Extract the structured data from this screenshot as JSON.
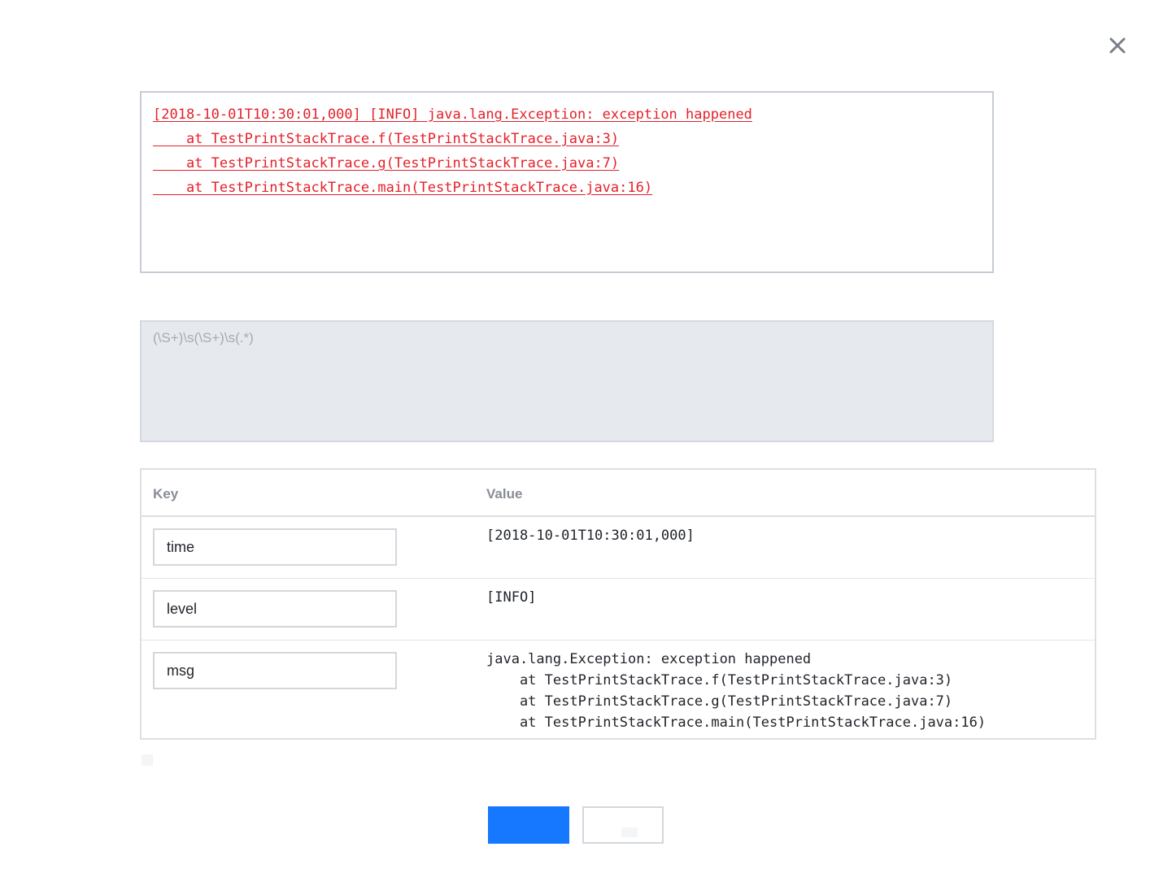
{
  "dialog": {
    "close_icon": "close-icon"
  },
  "log_sample": {
    "lines": [
      "[2018-10-01T10:30:01,000] [INFO] java.lang.Exception: exception happened",
      "    at TestPrintStackTrace.f(TestPrintStackTrace.java:3)",
      "    at TestPrintStackTrace.g(TestPrintStackTrace.java:7)",
      "    at TestPrintStackTrace.main(TestPrintStackTrace.java:16)"
    ],
    "text_color": "#e5202a"
  },
  "regex": {
    "value": "(\\S+)\\s(\\S+)\\s(.*)"
  },
  "kv_table": {
    "headers": {
      "key": "Key",
      "value": "Value"
    },
    "rows": [
      {
        "key": "time",
        "value": "[2018-10-01T10:30:01,000]"
      },
      {
        "key": "level",
        "value": "[INFO]"
      },
      {
        "key": "msg",
        "value": "java.lang.Exception: exception happened\n    at TestPrintStackTrace.f(TestPrintStackTrace.java:3)\n    at TestPrintStackTrace.g(TestPrintStackTrace.java:7)\n    at TestPrintStackTrace.main(TestPrintStackTrace.java:16)"
      }
    ]
  },
  "footer": {
    "primary_label": "",
    "secondary_label": "",
    "primary_color": "#1677ff"
  }
}
